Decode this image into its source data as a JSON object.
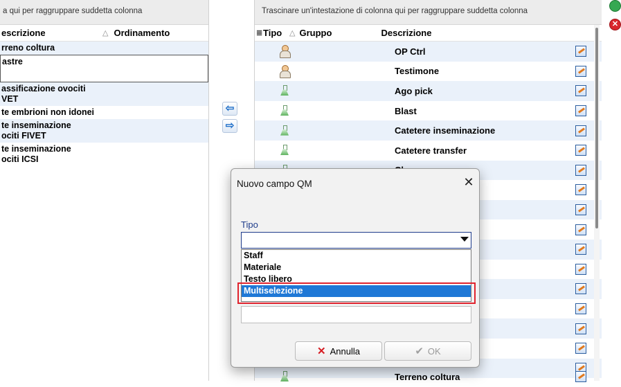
{
  "left_grid": {
    "group_hint": "a qui per raggruppare suddetta colonna",
    "columns": [
      "escrizione",
      "Ordinamento"
    ],
    "rows": [
      {
        "line1": "rreno coltura",
        "line2": ""
      },
      {
        "line1": "astre",
        "line2": ""
      },
      {
        "line1": "assificazione ovociti",
        "line2": "VET"
      },
      {
        "line1": "te embrioni non idonei",
        "line2": ""
      },
      {
        "line1": "te inseminazione",
        "line2": "ociti FIVET"
      },
      {
        "line1": "te inseminazione",
        "line2": "ociti ICSI"
      }
    ]
  },
  "right_grid": {
    "group_hint": "Trascinare un'intestazione di colonna qui per raggruppare suddetta colonna",
    "columns": [
      "Tipo",
      "Gruppo",
      "Descrizione"
    ],
    "rows": [
      {
        "icon": "person-icon",
        "descrizione": "OP Ctrl"
      },
      {
        "icon": "person-icon",
        "descrizione": "Testimone"
      },
      {
        "icon": "flask-icon",
        "descrizione": "Ago pick"
      },
      {
        "icon": "flask-icon",
        "descrizione": "Blast"
      },
      {
        "icon": "flask-icon",
        "descrizione": "Catetere inseminazione"
      },
      {
        "icon": "flask-icon",
        "descrizione": "Catetere transfer"
      },
      {
        "icon": "flask-icon",
        "descrizione": "Cleavage"
      }
    ],
    "last_row": "Terreno coltura"
  },
  "transfer_buttons": {
    "left": "⇦",
    "right": "⇨"
  },
  "dialog": {
    "title": "Nuovo campo QM",
    "close": "✕",
    "tipo_label": "Tipo",
    "tipo_value": "",
    "options": [
      "Staff",
      "Materiale",
      "Testo libero",
      "Multiselezione"
    ],
    "selected_option": "Multiselezione",
    "cancel_label": "Annulla",
    "ok_label": "OK"
  },
  "colors": {
    "selection": "#1f78d6",
    "highlight": "#e0232d",
    "alt_row": "#eaf1fa"
  }
}
